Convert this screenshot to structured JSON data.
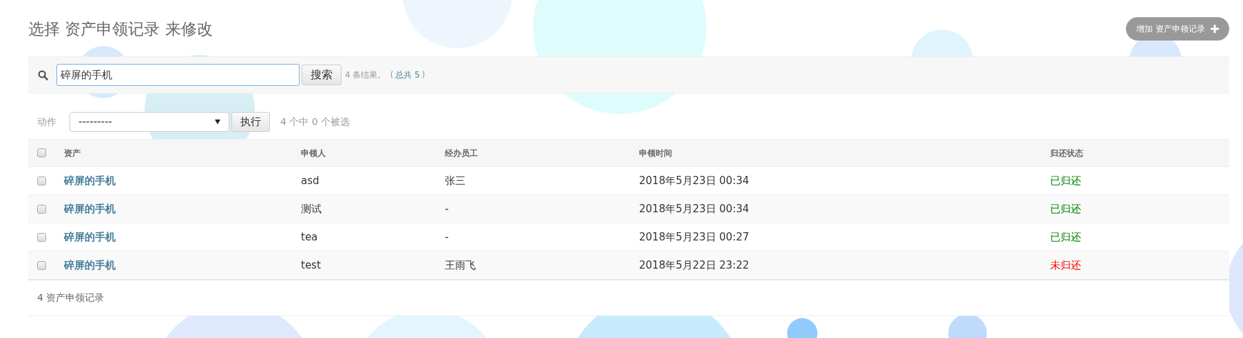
{
  "title": "选择 资产申领记录 来修改",
  "add_button": {
    "label": "增加 资产申领记录"
  },
  "search": {
    "value": "碎屏的手机",
    "button": "搜索",
    "result_count": "4 条结果。",
    "total_open": "(",
    "total_link": "总共 5",
    "total_close": ")"
  },
  "actions": {
    "label": "动作",
    "select_value": "---------",
    "run_button": "执行",
    "selection_counter": "4 个中 0 个被选"
  },
  "table": {
    "select_all_checked": false,
    "columns": [
      "资产",
      "申领人",
      "经办员工",
      "申领时间",
      "归还状态"
    ],
    "rows": [
      {
        "checked": false,
        "asset": "碎屏的手机",
        "applicant": "asd",
        "staff": "张三",
        "time": "2018年5月23日 00:34",
        "status": "已归还",
        "returned": true
      },
      {
        "checked": false,
        "asset": "碎屏的手机",
        "applicant": "测试",
        "staff": "-",
        "time": "2018年5月23日 00:34",
        "status": "已归还",
        "returned": true
      },
      {
        "checked": false,
        "asset": "碎屏的手机",
        "applicant": "tea",
        "staff": "-",
        "time": "2018年5月23日 00:27",
        "status": "已归还",
        "returned": true
      },
      {
        "checked": false,
        "asset": "碎屏的手机",
        "applicant": "test",
        "staff": "王雨飞",
        "time": "2018年5月22日 23:22",
        "status": "未归还",
        "returned": false
      }
    ]
  },
  "footer": "4 资产申领记录"
}
